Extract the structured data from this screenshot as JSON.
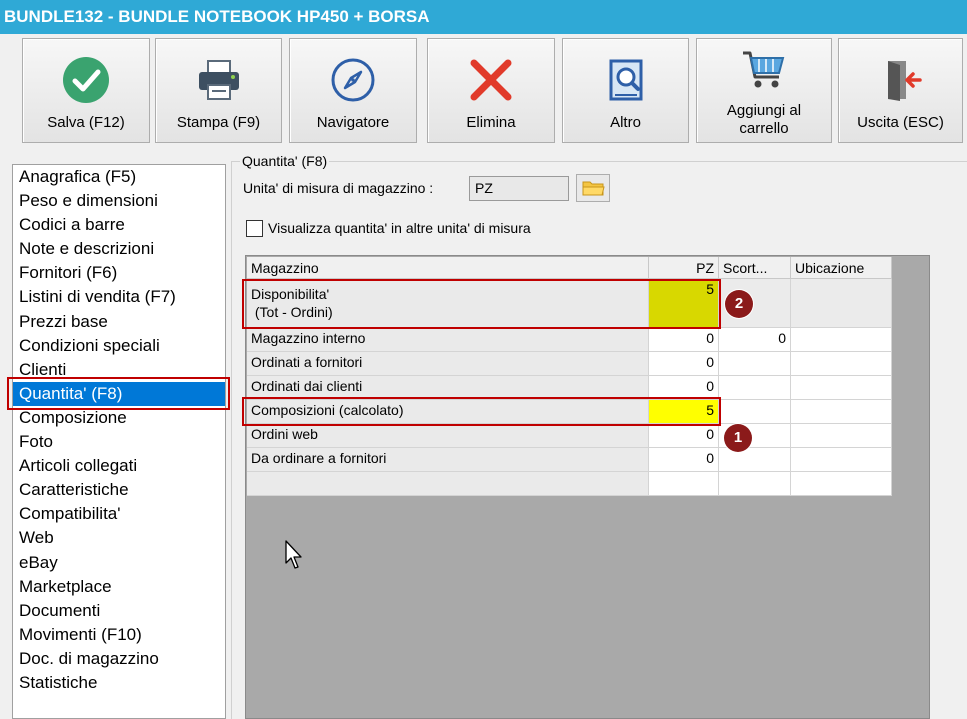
{
  "window": {
    "title": "BUNDLE132 - BUNDLE NOTEBOOK HP450 + BORSA"
  },
  "toolbar": {
    "buttons": [
      {
        "label": "Salva (F12)",
        "icon": "check-icon"
      },
      {
        "label": "Stampa (F9)",
        "icon": "printer-icon"
      },
      {
        "label": "Navigatore",
        "icon": "compass-icon"
      },
      {
        "label": "Elimina",
        "icon": "delete-x-icon"
      },
      {
        "label": "Altro",
        "icon": "search-book-icon"
      },
      {
        "label": "Aggiungi al carrello",
        "icon": "cart-icon"
      },
      {
        "label": "Uscita (ESC)",
        "icon": "exit-door-icon"
      }
    ]
  },
  "sidebar": {
    "items": [
      {
        "label": "Anagrafica (F5)"
      },
      {
        "label": "Peso e dimensioni"
      },
      {
        "label": "Codici a barre"
      },
      {
        "label": "Note e descrizioni"
      },
      {
        "label": "Fornitori (F6)"
      },
      {
        "label": "Listini di vendita (F7)"
      },
      {
        "label": "Prezzi base"
      },
      {
        "label": "Condizioni speciali"
      },
      {
        "label": "Clienti"
      },
      {
        "label": "Quantita' (F8)"
      },
      {
        "label": "Composizione"
      },
      {
        "label": "Foto"
      },
      {
        "label": "Articoli collegati"
      },
      {
        "label": "Caratteristiche"
      },
      {
        "label": "Compatibilita'"
      },
      {
        "label": "Web"
      },
      {
        "label": "eBay"
      },
      {
        "label": "Marketplace"
      },
      {
        "label": "Documenti"
      },
      {
        "label": "Movimenti (F10)"
      },
      {
        "label": "Doc. di magazzino"
      },
      {
        "label": "Statistiche"
      }
    ],
    "selected": "Quantita' (F8)"
  },
  "quantita": {
    "group_title": "Quantita' (F8)",
    "um_label": "Unita' di misura di magazzino :",
    "um_value": "PZ",
    "checkbox_label": "Visualizza quantita' in altre unita' di misura",
    "checkbox_checked": false,
    "grid": {
      "headers": {
        "name": "Magazzino",
        "pz": "PZ",
        "scorta": "Scort...",
        "ubicazione": "Ubicazione"
      },
      "rows": [
        {
          "name_line1": "Disponibilita'",
          "name_line2": " (Tot - Ordini)",
          "pz": "5",
          "scorta": ""
        },
        {
          "name_line1": "Magazzino interno",
          "pz": "0",
          "scorta": "0"
        },
        {
          "name_line1": "Ordinati a fornitori",
          "pz": "0",
          "scorta": ""
        },
        {
          "name_line1": "Ordinati dai clienti",
          "pz": "0",
          "scorta": ""
        },
        {
          "name_line1": "Composizioni (calcolato)",
          "pz": "5",
          "scorta": ""
        },
        {
          "name_line1": "Ordini web",
          "pz": "0",
          "scorta": ""
        },
        {
          "name_line1": "Da ordinare a fornitori",
          "pz": "0",
          "scorta": ""
        },
        {
          "name_line1": "",
          "pz": "",
          "scorta": ""
        }
      ]
    }
  },
  "annotations": {
    "badge1": "1",
    "badge2": "2"
  },
  "colors": {
    "title_bar": "#2fa9d6",
    "selection": "#0078d7",
    "highlight_dark": "#d8d800",
    "highlight": "#ffff00",
    "callout": "#c00000"
  }
}
